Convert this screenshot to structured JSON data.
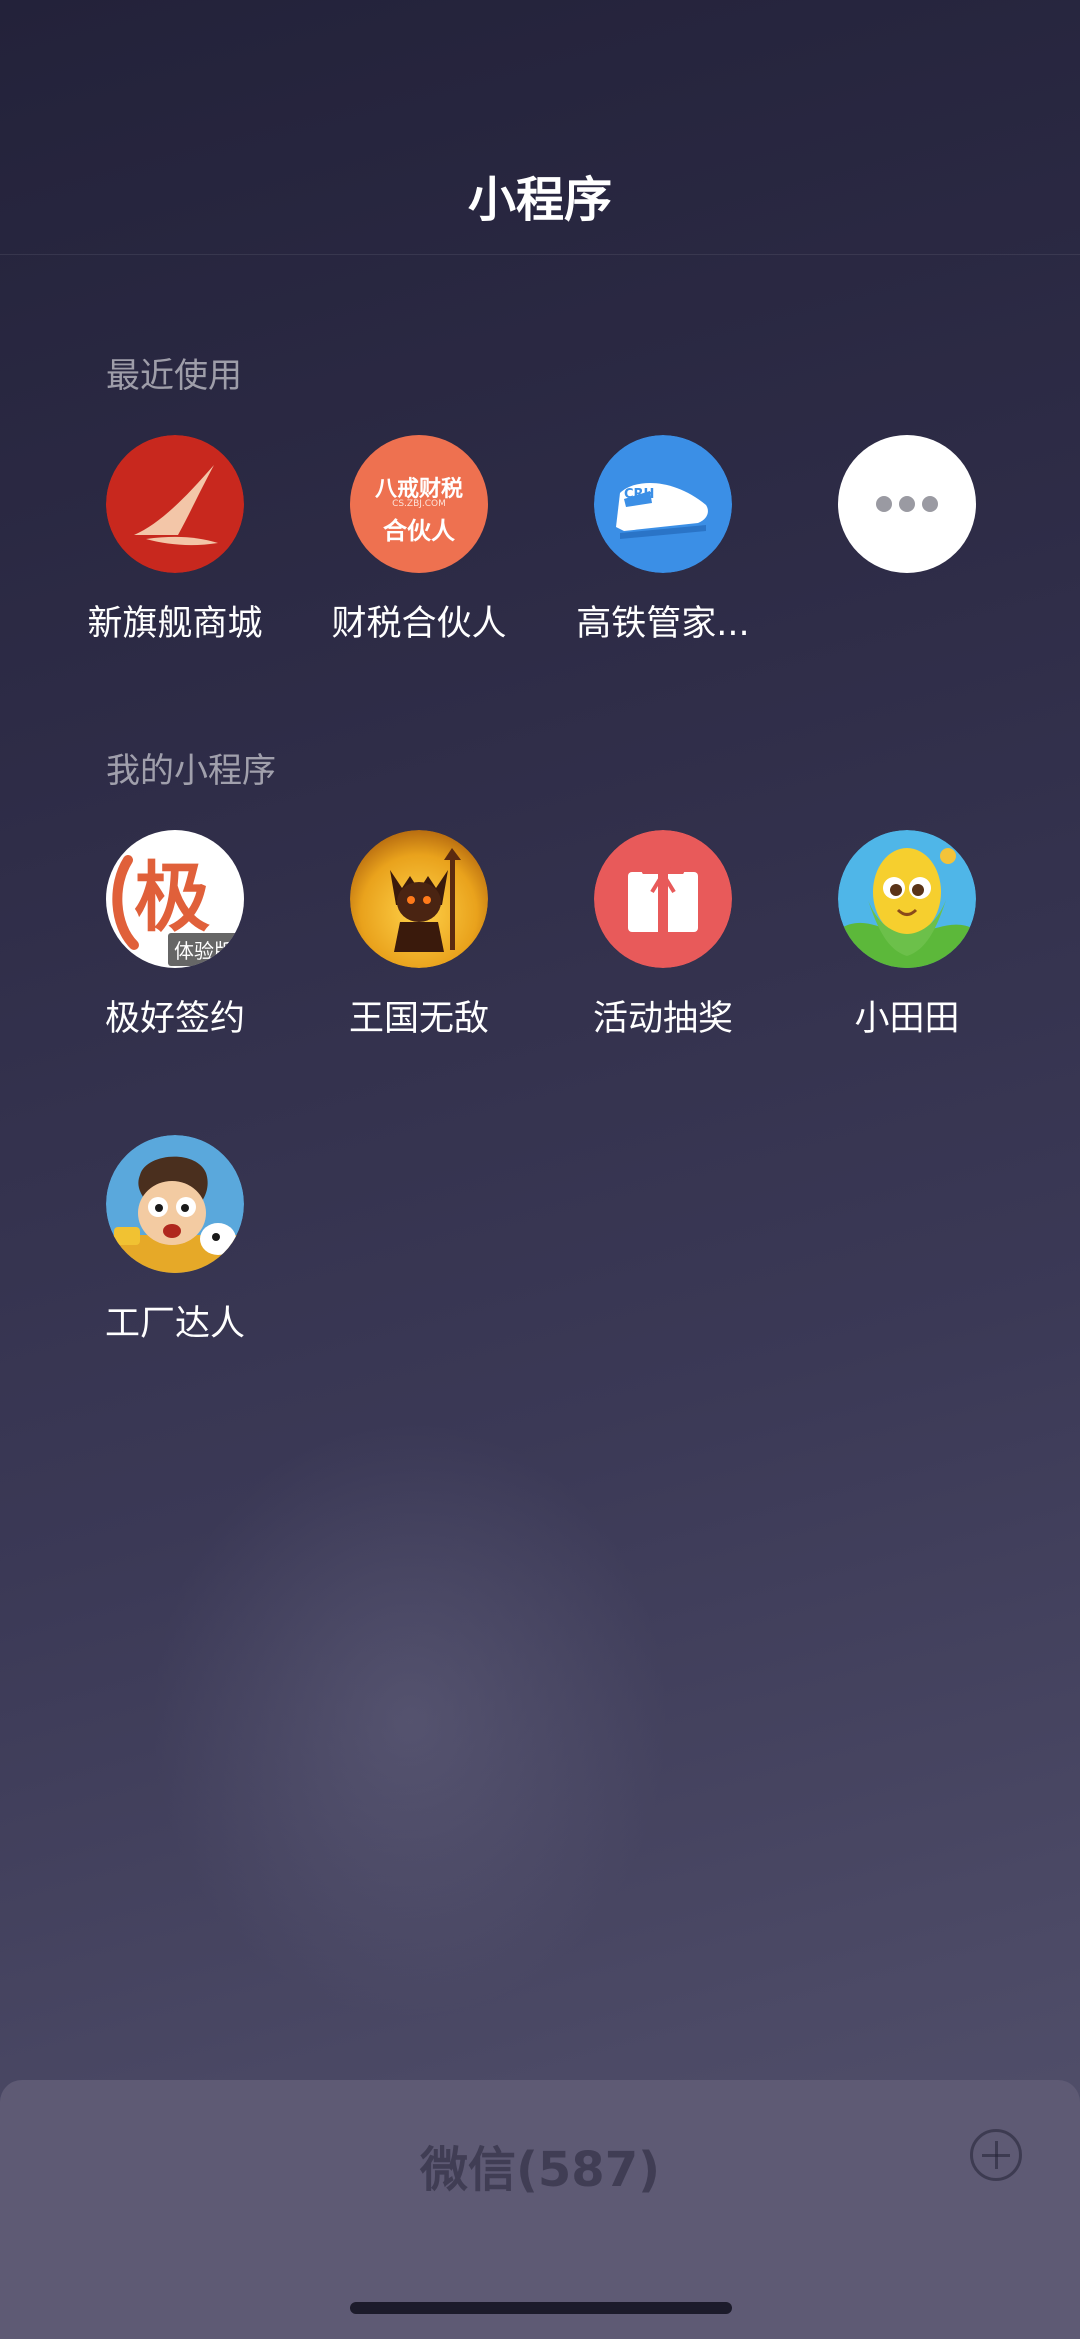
{
  "header": {
    "title": "小程序"
  },
  "recent": {
    "title": "最近使用",
    "items": [
      {
        "label": "新旗舰商城",
        "icon": "flagship-mall-icon"
      },
      {
        "label": "财税合伙人",
        "icon": "tax-partner-icon",
        "icon_text_top": "八戒财税",
        "icon_text_mid": "CS.ZBJ.COM",
        "icon_text_bottom": "合伙人"
      },
      {
        "label": "高铁管家...",
        "icon": "train-butler-icon",
        "icon_text": "CRH"
      },
      {
        "label": "",
        "icon": "more-icon"
      }
    ]
  },
  "mine": {
    "title": "我的小程序",
    "items": [
      {
        "label": "极好签约",
        "icon": "jihao-sign-icon",
        "icon_text": "极",
        "badge": "体验版"
      },
      {
        "label": "王国无敌",
        "icon": "kingdom-game-icon"
      },
      {
        "label": "活动抽奖",
        "icon": "gift-lottery-icon"
      },
      {
        "label": "小田田",
        "icon": "corn-character-icon"
      },
      {
        "label": "工厂达人",
        "icon": "factory-game-icon"
      }
    ]
  },
  "bottom": {
    "title": "微信(587)"
  },
  "colors": {
    "background_top": "#23223a",
    "background_bottom": "#55536d",
    "sheet": "#5e5a74",
    "red_icon": "#c8281e",
    "orange_icon": "#ee7150",
    "blue_icon": "#3b8fe6",
    "gift_icon": "#e85a5a"
  }
}
